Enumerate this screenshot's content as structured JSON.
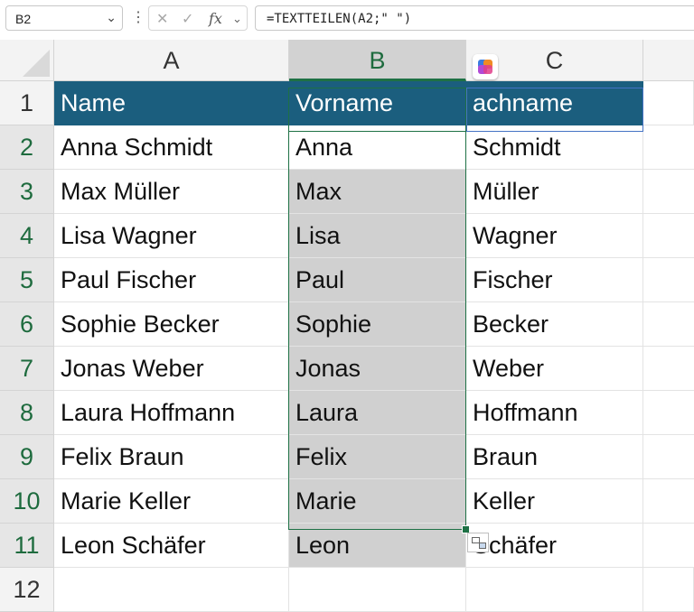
{
  "formula_bar": {
    "name_box": "B2",
    "formula": "=TEXTTEILEN(A2;\" \")",
    "cancel_icon": "x-icon",
    "confirm_icon": "check-icon",
    "function_icon": "fx-icon"
  },
  "columns": [
    "A",
    "B",
    "C"
  ],
  "rows": [
    "1",
    "2",
    "3",
    "4",
    "5",
    "6",
    "7",
    "8",
    "9",
    "10",
    "11",
    "12"
  ],
  "header": {
    "a": "Name",
    "b": "Vorname",
    "c": "achname"
  },
  "data": [
    {
      "a": "Anna Schmidt",
      "b": "Anna",
      "c": "Schmidt"
    },
    {
      "a": "Max Müller",
      "b": "Max",
      "c": "Müller"
    },
    {
      "a": "Lisa Wagner",
      "b": "Lisa",
      "c": "Wagner"
    },
    {
      "a": "Paul Fischer",
      "b": "Paul",
      "c": "Fischer"
    },
    {
      "a": "Sophie Becker",
      "b": "Sophie",
      "c": "Becker"
    },
    {
      "a": "Jonas Weber",
      "b": "Jonas",
      "c": "Weber"
    },
    {
      "a": "Laura Hoffmann",
      "b": "Laura",
      "c": "Hoffmann"
    },
    {
      "a": "Felix Braun",
      "b": "Felix",
      "c": "Braun"
    },
    {
      "a": "Marie Keller",
      "b": "Marie",
      "c": "Keller"
    },
    {
      "a": "Leon Schäfer",
      "b": "Leon",
      "c": "Schäfer"
    }
  ],
  "colors": {
    "header_fill": "#1b5e7e",
    "selection": "#1e7145",
    "spill_fill": "#d0d0d0"
  }
}
